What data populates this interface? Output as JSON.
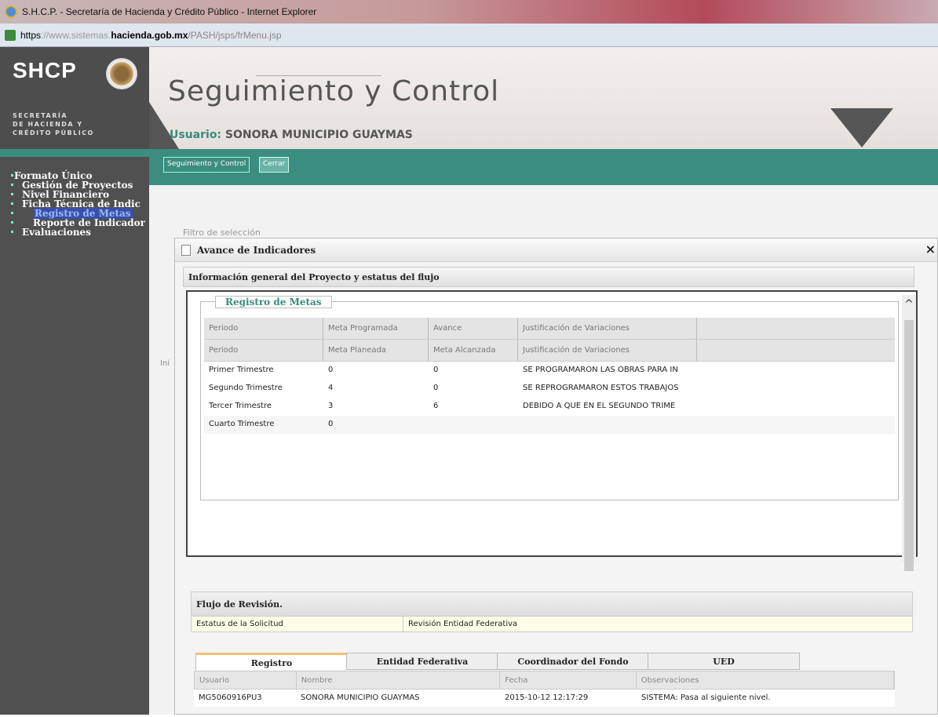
{
  "browser": {
    "title": "S.H.C.P. - Secretaría de Hacienda y Crédito Público - Internet Explorer",
    "url_scheme": "https",
    "url_host_prefix": "://www.sistemas.",
    "url_domain": "hacienda.gob.mx",
    "url_path": "/PASH/jsps/frMenu.jsp"
  },
  "header": {
    "logo_text": "SHCP",
    "logo_sub": [
      "SECRETARÍA",
      "DE HACIENDA Y",
      "CRÉDITO PÚBLICO"
    ],
    "app_title": "Seguimiento y Control",
    "user_label": "Usuario:",
    "user_name": "SONORA MUNICIPIO GUAYMAS"
  },
  "nav": {
    "tabs": [
      {
        "label": "Seguimiento y Control"
      },
      {
        "label": "Cerrar"
      }
    ]
  },
  "sidebar": {
    "items": [
      {
        "label": "Formato Único"
      },
      {
        "label": "Gestión de Proyectos"
      },
      {
        "label": "Nivel Financiero"
      },
      {
        "label": "Ficha Técnica de Indic"
      },
      {
        "label": "Registro de Metas"
      },
      {
        "label": "Reporte de Indicador"
      },
      {
        "label": "Evaluaciones"
      }
    ]
  },
  "background": {
    "filter_label": "Filtro de selección",
    "partial": "Ini"
  },
  "modal": {
    "title": "Avance de Indicadores",
    "close": "×",
    "section_title": "Información general del Proyecto y estatus del flujo",
    "metas": {
      "legend": "Registro de Metas",
      "header1": [
        "Periodo",
        "Meta Programada",
        "Avance",
        "Justificación de Variaciones"
      ],
      "header2": [
        "Periodo",
        "Meta Planeada",
        "Meta Alcanzada",
        "Justificación de Variaciones"
      ],
      "rows": [
        [
          "Primer Trimestre",
          "0",
          "0",
          "SE PROGRAMARON LAS OBRAS PARA IN"
        ],
        [
          "Segundo Trimestre",
          "4",
          "0",
          "SE REPROGRAMARON ESTOS TRABAJOS"
        ],
        [
          "Tercer Trimestre",
          "3",
          "6",
          "DEBIDO A QUE EN EL SEGUNDO TRIME"
        ],
        [
          "Cuarto Trimestre",
          "0",
          "",
          ""
        ]
      ]
    },
    "flujo": {
      "title": "Flujo de Revisión.",
      "status_label": "Estatus de la Solicitud",
      "status_value": "Revisión Entidad Federativa",
      "tabs": [
        "Registro",
        "Entidad Federativa",
        "Coordinador del Fondo",
        "UED"
      ],
      "columns": [
        "Usuario",
        "Nombre",
        "Fecha",
        "Observaciones"
      ],
      "rows": [
        [
          "MG5060916PU3",
          "SONORA MUNICIPIO GUAYMAS",
          "2015-10-12 12:17:29",
          "SISTEMA: Pasa al siguiente nivel."
        ]
      ]
    }
  },
  "colors": {
    "teal": "#3b8d7f",
    "sidebar": "#505050",
    "selected": "#3a4fa8"
  }
}
